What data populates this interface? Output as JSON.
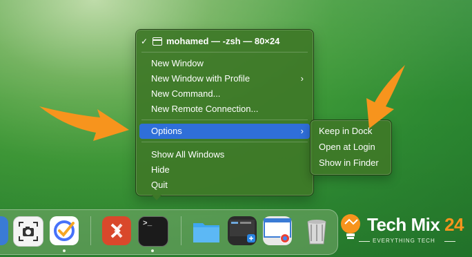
{
  "menu": {
    "title": "mohamed — -zsh — 80×24",
    "check": "✓",
    "items": [
      {
        "label": "New Window"
      },
      {
        "label": "New Window with Profile",
        "chevron": "›"
      },
      {
        "label": "New Command..."
      },
      {
        "label": "New Remote Connection..."
      }
    ],
    "options": {
      "label": "Options",
      "chevron": "›"
    },
    "items2": [
      {
        "label": "Show All Windows"
      },
      {
        "label": "Hide"
      },
      {
        "label": "Quit"
      }
    ]
  },
  "submenu": {
    "items": [
      {
        "label": "Keep in Dock"
      },
      {
        "label": "Open at Login"
      },
      {
        "label": "Show in Finder"
      }
    ]
  },
  "dock": {
    "apps": [
      {
        "name": "screenshot-app-icon"
      },
      {
        "name": "ticktick-app-icon"
      },
      {
        "name": "remote-desktop-app-icon"
      },
      {
        "name": "terminal-app-icon"
      },
      {
        "name": "downloads-folder-icon"
      },
      {
        "name": "recent-windows-stack-icon"
      },
      {
        "name": "window-preview-icon"
      },
      {
        "name": "trash-icon"
      }
    ],
    "terminal_prompt": ">_"
  },
  "watermark": {
    "brand": "Tech Mix",
    "number": "24",
    "tagline": "EVERYTHING TECH"
  },
  "colors": {
    "accent": "#2f6fd9",
    "arrow": "#f7941d",
    "menu_bg": "#3e7828"
  }
}
